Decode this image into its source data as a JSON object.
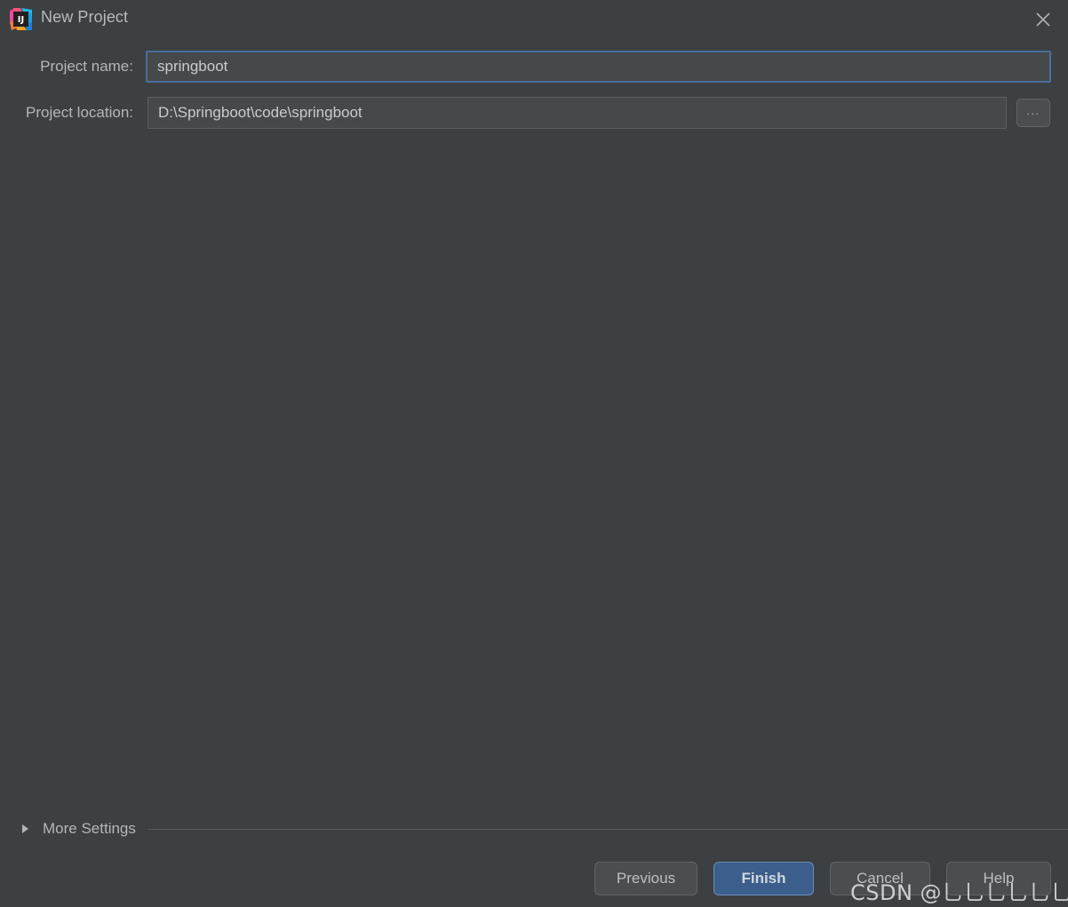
{
  "window": {
    "title": "New Project",
    "app_icon": "intellij-idea-icon",
    "close_icon": "close-icon",
    "background_color": "#3c4042"
  },
  "form": {
    "fields": [
      {
        "label": "Project name:",
        "value": "springboot",
        "placeholder": "",
        "focused": true,
        "focus_border_color": "#4a6f9b"
      },
      {
        "label": "Project location:",
        "value": "D:\\Springboot\\code\\springboot",
        "placeholder": "",
        "focused": false,
        "browse_button": {
          "label": "...",
          "icon": "ellipsis-icon"
        }
      }
    ]
  },
  "more_settings": {
    "label": "More Settings",
    "expanded": false,
    "arrow_icon": "triangle-right-icon"
  },
  "buttons": {
    "previous": "Previous",
    "finish": "Finish",
    "cancel": "Cancel",
    "help": "Help",
    "primary_color": "#3c5e8c"
  },
  "watermark": {
    "text": "CSDN @乚乚乚乚乚乚乚乚_"
  }
}
